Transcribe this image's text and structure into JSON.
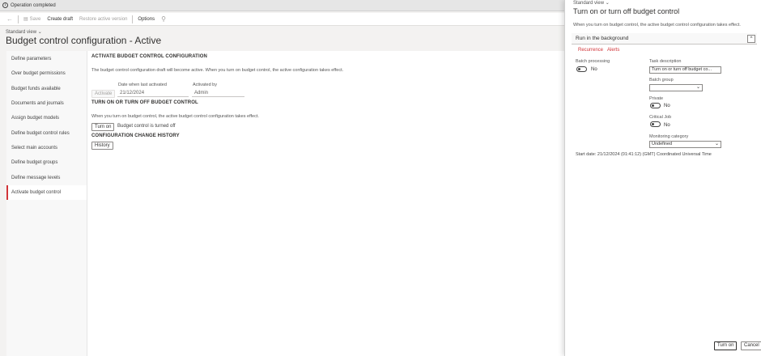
{
  "notification": {
    "icon": "info-icon",
    "text": "Operation completed"
  },
  "toolbar": {
    "save_label": "Save",
    "create_draft_label": "Create draft",
    "restore_label": "Restore active version",
    "options_label": "Options"
  },
  "breadcrumb": "Standard view",
  "page_title": "Budget control configuration - Active",
  "nav_items": [
    "Define parameters",
    "Over budget permissions",
    "Budget funds available",
    "Documents and journals",
    "Assign budget models",
    "Define budget control rules",
    "Select main accounts",
    "Define budget groups",
    "Define message levels",
    "Activate budget control"
  ],
  "activate_section": {
    "heading": "ACTIVATE BUDGET CONTROL CONFIGURATION",
    "description": "The budget control configuration draft will become active. When you turn on budget control, the active configuration takes effect.",
    "activate_button": "Activate",
    "date_label": "Date when last activated",
    "date_value": "21/12/2024",
    "activated_by_label": "Activated by",
    "activated_by_value": "Admin"
  },
  "turn_on_section": {
    "heading": "TURN ON OR TURN OFF BUDGET CONTROL",
    "description": "When you turn on budget control, the active budget control configuration takes effect.",
    "button": "Turn on",
    "status": "Budget control is turned off"
  },
  "history_section": {
    "heading": "CONFIGURATION CHANGE HISTORY",
    "button": "History"
  },
  "dialog": {
    "breadcrumb": "Standard view",
    "title": "Turn on or turn off budget control",
    "description": "When you turn on budget control, the active budget control configuration takes effect.",
    "fasttab_title": "Run in the background",
    "links": [
      "Recurrence",
      "Alerts"
    ],
    "batch_processing_label": "Batch processing",
    "batch_processing_value": "No",
    "task_description_label": "Task description",
    "task_description_value": "Turn on or turn off budget co...",
    "batch_group_label": "Batch group",
    "batch_group_value": "",
    "private_label": "Private",
    "private_value": "No",
    "critical_job_label": "Critical Job",
    "critical_job_value": "No",
    "monitoring_category_label": "Monitoring category",
    "monitoring_category_value": "Undefined",
    "start_date": "Start date: 21/12/2024 (01:41:12) (GMT) Coordinated Universal Time",
    "ok_button": "Turn on",
    "cancel_button": "Cancel"
  },
  "colors": {
    "accent": "#d13438",
    "background": "#f3f2f1"
  }
}
